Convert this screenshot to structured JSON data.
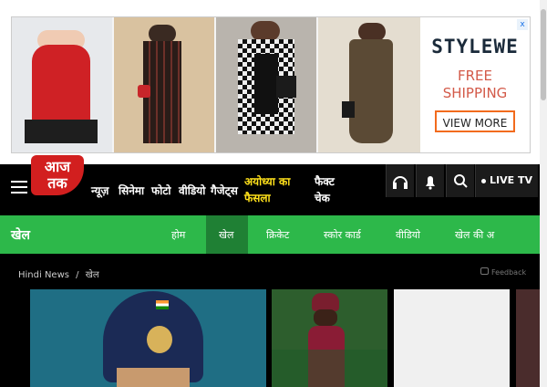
{
  "ad": {
    "brand": "STYLEWE",
    "offer_line1": "FREE",
    "offer_line2": "SHIPPING",
    "cta": "VIEW MORE",
    "close_glyph": "x"
  },
  "header": {
    "logo_line1": "आज",
    "logo_line2": "तक",
    "nav": [
      "न्यूज़",
      "सिनेमा",
      "फोटो",
      "वीडियो",
      "गैजेट्स"
    ],
    "highlight": "अयोध्या का फैसला",
    "fact_check": "फैक्ट चेक",
    "live_label": "LIVE TV"
  },
  "section": {
    "title": "खेल",
    "tabs": [
      "होम",
      "खेल",
      "क्रिकेट",
      "स्कोर कार्ड",
      "वीडियो",
      "खेल की अ"
    ],
    "active_tab": "खेल"
  },
  "breadcrumb": {
    "home": "Hindi News",
    "separator": "/",
    "current": "खेल"
  },
  "feedback_label": "Feedback",
  "icons": [
    "menu-icon",
    "headphones-icon",
    "bell-icon",
    "search-icon",
    "live-dot-icon"
  ],
  "colors": {
    "brand_red": "#d21f1f",
    "sports_green": "#2db84a",
    "highlight_yellow": "#ffe11b"
  }
}
